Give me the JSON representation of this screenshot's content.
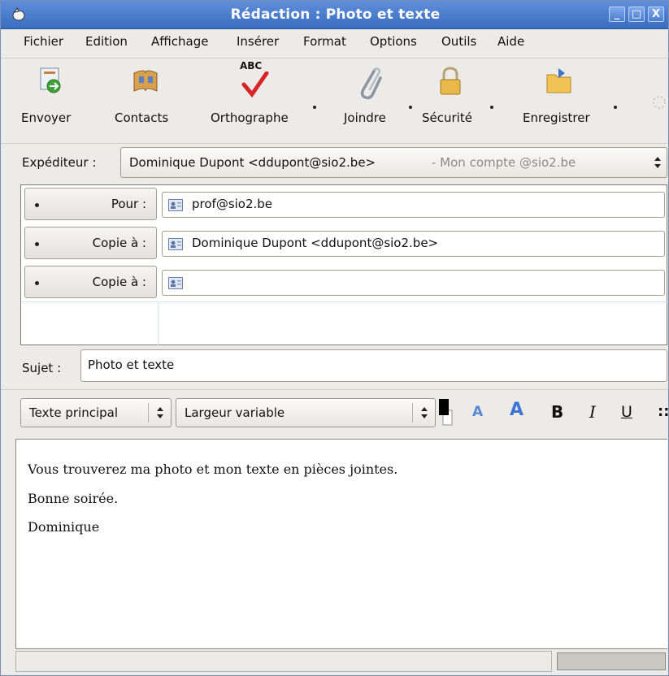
{
  "window": {
    "title": "Rédaction : Photo et texte",
    "minimize": "_",
    "maximize": "□",
    "close": "X"
  },
  "menu": [
    {
      "label": "Fichier"
    },
    {
      "label": "Edition"
    },
    {
      "label": "Affichage"
    },
    {
      "label": "Insérer"
    },
    {
      "label": "Format"
    },
    {
      "label": "Options"
    },
    {
      "label": "Outils"
    },
    {
      "label": "Aide"
    }
  ],
  "toolbar": {
    "send": "Envoyer",
    "contacts": "Contacts",
    "spelling": "Orthographe",
    "attach": "Joindre",
    "security": "Sécurité",
    "save": "Enregistrer",
    "spell_badge": "ABC"
  },
  "sender": {
    "label": "Expéditeur :",
    "value": "Dominique Dupont <ddupont@sio2.be>",
    "account": "- Mon compte @sio2.be"
  },
  "recipients": [
    {
      "type": "Pour :",
      "value": "prof@sio2.be"
    },
    {
      "type": "Copie à :",
      "value": "Dominique Dupont <ddupont@sio2.be>"
    },
    {
      "type": "Copie à :",
      "value": ""
    }
  ],
  "subject": {
    "label": "Sujet :",
    "value": "Photo et texte"
  },
  "format": {
    "paragraph_style": "Texte principal",
    "font": "Largeur variable",
    "smaller": "A",
    "larger": "A",
    "bold": "B",
    "italic": "I",
    "underline": "U",
    "more": "::"
  },
  "body": {
    "lines": [
      "Vous trouverez ma photo et mon texte en pièces jointes.",
      "Bonne soirée.",
      "Dominique"
    ]
  },
  "colors": {
    "titlebar": "#3a6cc0",
    "window_bg": "#ecebe8",
    "text_color": "#000000"
  }
}
